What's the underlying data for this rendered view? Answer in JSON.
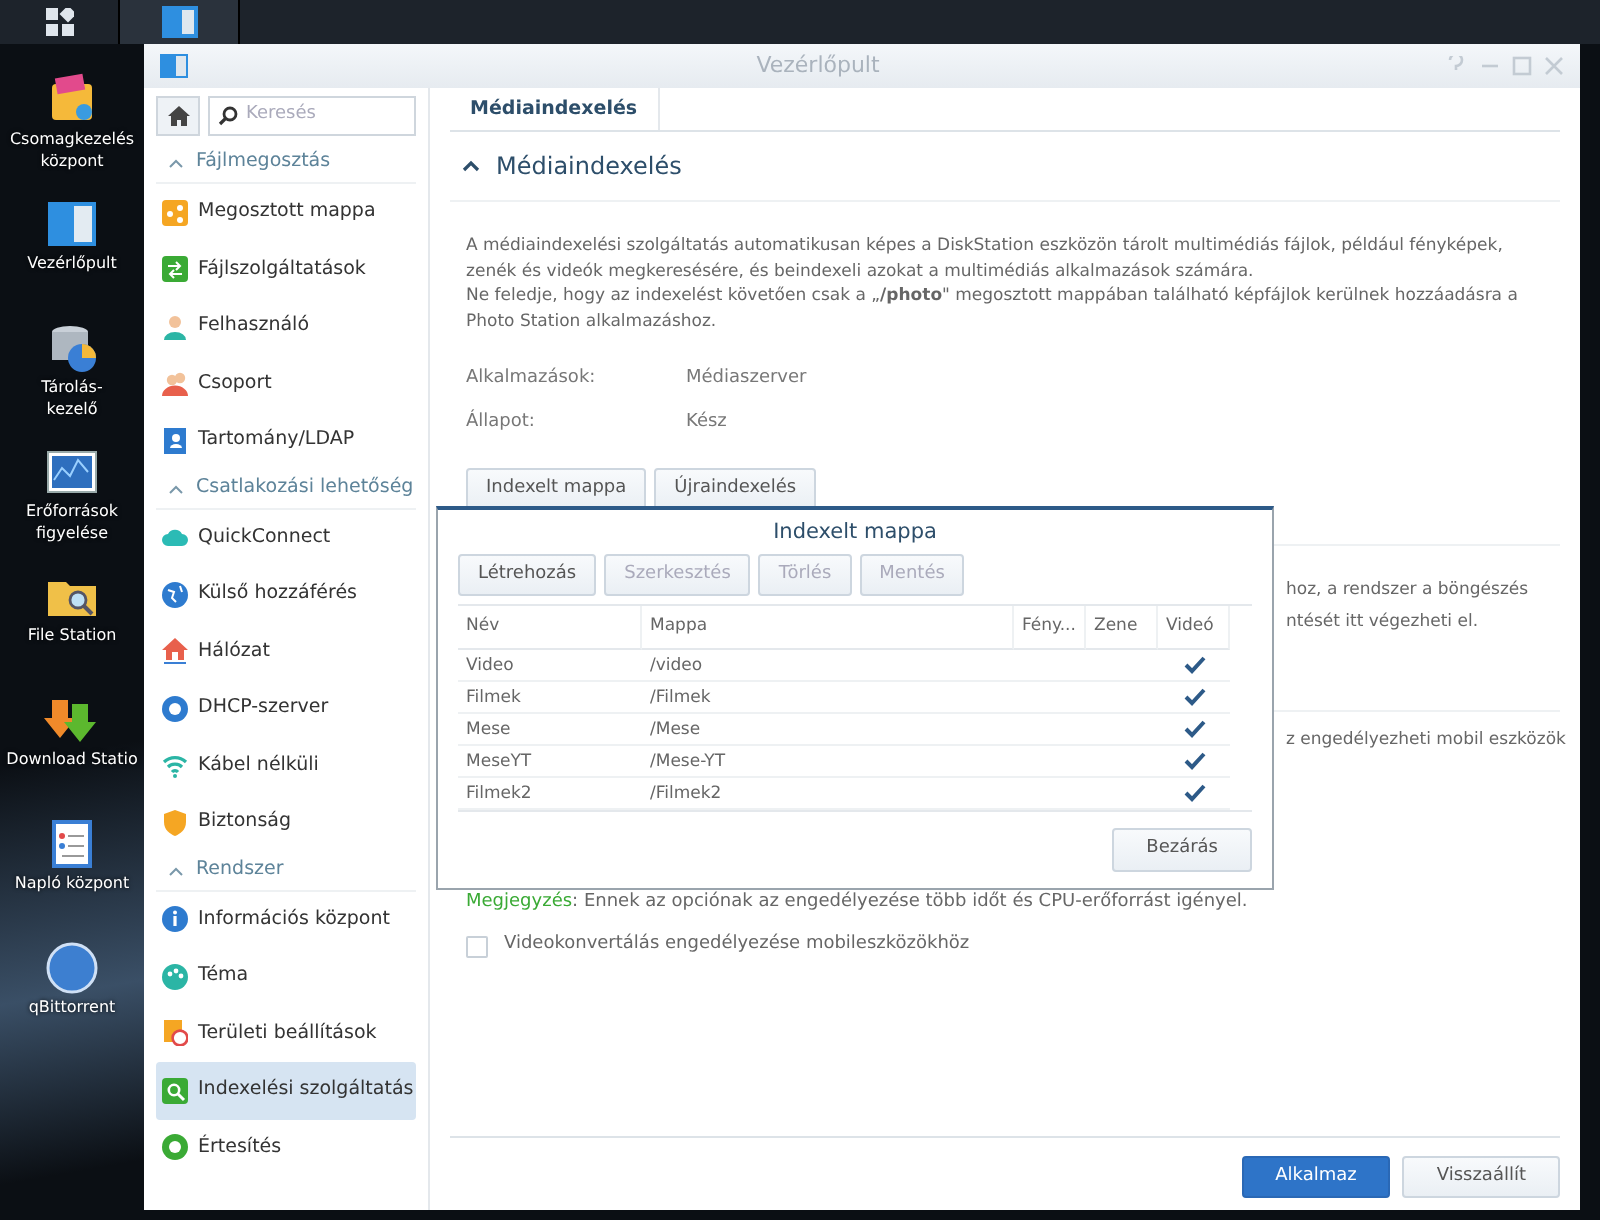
{
  "window": {
    "title": "Vezérlőpult"
  },
  "desktop_icons": [
    {
      "kind": "package",
      "label": [
        "Csomagkezelés",
        "központ"
      ]
    },
    {
      "kind": "control",
      "label": [
        "Vezérlőpult"
      ]
    },
    {
      "kind": "storage",
      "label": [
        "Tárolás-",
        "kezelő"
      ]
    },
    {
      "kind": "monitor",
      "label": [
        "Erőforrások",
        "figyelése"
      ]
    },
    {
      "kind": "folder",
      "label": [
        "File Station"
      ]
    },
    {
      "kind": "download",
      "label": [
        "Download Statio"
      ]
    },
    {
      "kind": "log",
      "label": [
        "Napló központ"
      ]
    },
    {
      "kind": "qb",
      "label": [
        "qBittorrent"
      ]
    }
  ],
  "sidebar": {
    "search": {
      "placeholder": "Keresés"
    },
    "sections": [
      {
        "title": "Fájlmegosztás",
        "items": [
          {
            "label": "Megosztott mappa",
            "kind": "share",
            "selected": false
          },
          {
            "label": "Fájlszolgáltatások",
            "kind": "file",
            "selected": false
          },
          {
            "label": "Felhasználó",
            "kind": "user",
            "selected": false
          },
          {
            "label": "Csoport",
            "kind": "group",
            "selected": false
          },
          {
            "label": "Tartomány/LDAP",
            "kind": "book",
            "selected": false
          }
        ]
      },
      {
        "title": "Csatlakozási lehetőség",
        "items": [
          {
            "label": "QuickConnect",
            "kind": "cloud",
            "selected": false
          },
          {
            "label": "Külső hozzáférés",
            "kind": "globe",
            "selected": false
          },
          {
            "label": "Hálózat",
            "kind": "house",
            "selected": false
          },
          {
            "label": "DHCP-szerver",
            "kind": "dhcp",
            "selected": false
          },
          {
            "label": "Kábel nélküli",
            "kind": "wifi",
            "selected": false
          },
          {
            "label": "Biztonság",
            "kind": "shield",
            "selected": false
          }
        ]
      },
      {
        "title": "Rendszer",
        "items": [
          {
            "label": "Információs központ",
            "kind": "info",
            "selected": false
          },
          {
            "label": "Téma",
            "kind": "palette",
            "selected": false
          },
          {
            "label": "Területi beállítások",
            "kind": "clock",
            "selected": false
          },
          {
            "label": "Indexelési szolgáltatás",
            "kind": "search",
            "selected": true
          },
          {
            "label": "Értesítés",
            "kind": "notify",
            "selected": false
          }
        ]
      }
    ]
  },
  "tabs": [
    {
      "label": "Médiaindexelés",
      "selected": true
    }
  ],
  "section": {
    "title": "Médiaindexelés",
    "expanded": true,
    "description": [
      "A médiaindexelési szolgáltatás automatikusan képes a DiskStation eszközön tárolt multimédiás fájlok, például fényképek, zenék és videók megkeresésére, és beindexeli azokat a multimédiás alkalmazások számára.",
      "Ne feledje, hogy az indexelést követően csak a „**/photo**\" megosztott mappában található képfájlok kerülnek hozzáadásra a Photo Station alkalmazáshoz."
    ],
    "fields": [
      {
        "label": "Alkalmazások:",
        "value": "Médiaszerver"
      },
      {
        "label": "Állapot:",
        "value": "Kész"
      }
    ],
    "buttons": [
      "Indexelt mappa",
      "Újraindexelés"
    ]
  },
  "background_text": [
    "hoz, a rendszer a böngészés",
    "ntését itt végezheti el.",
    "z engedélyezheti mobil eszközök"
  ],
  "note": {
    "label": "Megjegyzés",
    "text": ": Ennek az opciónak az engedélyezése több időt és CPU-erőforrást igényel."
  },
  "option": {
    "label": "Videokonvertálás engedélyezése mobileszközökhöz",
    "checked": false
  },
  "footer_buttons": [
    {
      "label": "Alkalmaz",
      "primary": true
    },
    {
      "label": "Visszaállít",
      "primary": false
    }
  ],
  "dialog": {
    "title": "Indexelt mappa",
    "toolbar": [
      {
        "label": "Létrehozás",
        "disabled": false
      },
      {
        "label": "Szerkesztés",
        "disabled": true
      },
      {
        "label": "Törlés",
        "disabled": true
      },
      {
        "label": "Mentés",
        "disabled": true
      }
    ],
    "columns": [
      "Név",
      "Mappa",
      "Fény...",
      "Zene",
      "Videó"
    ],
    "rows": [
      {
        "name": "Video",
        "folder": "/video",
        "video": true
      },
      {
        "name": "Filmek",
        "folder": "/Filmek",
        "video": true
      },
      {
        "name": "Mese",
        "folder": "/Mese",
        "video": true
      },
      {
        "name": "MeseYT",
        "folder": "/Mese-YT",
        "video": true
      },
      {
        "name": "Filmek2",
        "folder": "/Filmek2",
        "video": true
      }
    ],
    "close": "Bezárás"
  }
}
